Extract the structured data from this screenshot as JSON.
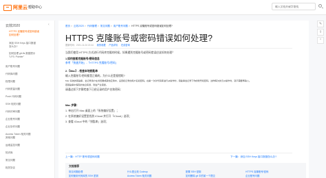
{
  "header": {
    "logo_text": "阿里云",
    "help_label": "帮助中心",
    "search_placeholder": "输入文档关键字查找"
  },
  "sidebar": {
    "title": "云效2020",
    "toggle_glyph": "‹",
    "items": [
      {
        "label": "HTTPS 克隆账号或密码错误",
        "active": true
      },
      {
        "label": "如何处理?",
        "active": true
      },
      {
        "label": "添加 SSH Keys 接口报错",
        "active": false
      },
      {
        "label": "怎么办?",
        "active": false
      },
      {
        "label": "如何处理 git-lfs 报错提示",
        "active": false
      },
      {
        "label": "\"LFS: Pointer\"",
        "active": false
      },
      {
        "label": "用户账号问题",
        "active": false
      },
      {
        "label": "代码库问题",
        "active": false
      },
      {
        "label": "权限问题",
        "active": false
      },
      {
        "label": "代码质量问题",
        "active": false
      },
      {
        "label": "Push 代码问题",
        "active": false
      },
      {
        "label": "SSH 相关问题",
        "active": false
      },
      {
        "label": "代码评审问题",
        "active": false
      },
      {
        "label": "企业账号问题",
        "active": false
      },
      {
        "label": "企业协作问题",
        "active": false
      },
      {
        "label": "Access Token 相关问题",
        "active": false
      },
      {
        "label": "其他问题",
        "active": false
      },
      {
        "label": "运维监控问题",
        "active": false
      },
      {
        "label": "知识库",
        "active": false
      },
      {
        "label": "常见问题",
        "active": false
      },
      {
        "label": "相关协议",
        "active": false
      }
    ]
  },
  "breadcrumb": {
    "items": [
      "首页",
      "云效2020",
      "代码管理",
      "常见问题",
      "用户账号问题"
    ],
    "current": "HTTPS 克隆账号或密码错误如何处理?",
    "separator": ">"
  },
  "article": {
    "title": "HTTPS 克隆账号或密码错误如何处理?",
    "meta_date": "更新时间：2021-11-04 22:44",
    "meta_links": [
      "我的收藏",
      "产品详情",
      "在线咨询"
    ],
    "lines": [
      {
        "text": "当我们使用 HTTPS 方式进行代码库克隆的时候，如果遇到克隆账号或密码错误应该如何处理？",
        "style": "normal"
      },
      {
        "text": "1.如何查看克隆账号/密码信息",
        "style": "bold"
      },
      {
        "text": "参考「快速开始」-「HTTPS 克隆账号/密码」",
        "style": "link"
      },
      {
        "text": "2.【Mac】- 检查本地钥匙串",
        "style": "bold"
      },
      {
        "text": "输入克隆账号/密码都是正确的，为什么还是报错呢?",
        "style": "normal"
      },
      {
        "text": "Mac 系统的钥匙串，会记录用户在浏览器或其他应用中，设置和记录的用户名和密码。在第一次对代码库进行git操作时，钥匙串会记录下你的账号和密码，这样每次执行git操作时，就不需要再输入。",
        "style": "small"
      },
      {
        "text": "若钥匙串中保存的信息有误，则会产生错误。",
        "style": "small"
      },
      {
        "text": "请通过如下步骤检查下已经记录的用户名和密码：",
        "style": "normal"
      },
      {
        "text": "Mac 步骤：",
        "style": "bold"
      },
      {
        "text": "1. 单击打开 Mac 桌面上的「系统偏好设置」；",
        "style": "normal"
      },
      {
        "text": "2. 在系统偏好设置里找到 iCloud 并打开「iCloud」选项；",
        "style": "normal"
      },
      {
        "text": "3. 查看 iCloud 中的「钥匙串」选项；",
        "style": "normal"
      }
    ],
    "prev_link": "上一篇：HTTP 账号或密码问题",
    "next_link": "下一篇：添加 SSH Keys 接口报错怎么办?"
  },
  "related": {
    "title": "文档推荐",
    "links": [
      "常见问题处理",
      "什么是云效 Codeup",
      "配置 SSH 密钥",
      "HTTPS 克隆账号/密码",
      "如何使用代码库的 SSH 密钥",
      "Access Token 相关问题",
      "如何删除 git 中的某一个提交",
      "企业账号问题"
    ]
  },
  "side_tools": [
    {
      "name": "feedback-icon",
      "glyph": "✎"
    },
    {
      "name": "share-icon",
      "glyph": "⇪"
    },
    {
      "name": "back-to-top-icon",
      "glyph": "⌃"
    }
  ],
  "colors": {
    "brand": "#ff6a00",
    "link": "#1677ff"
  }
}
